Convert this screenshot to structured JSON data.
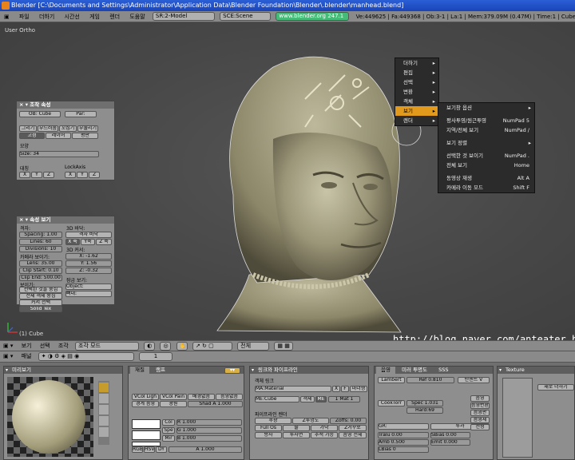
{
  "window": {
    "title": "Blender [C:\\Documents and Settings\\Administrator\\Application Data\\Blender Foundation\\Blender\\.blender\\manhead.blend]"
  },
  "menubar": {
    "items": [
      "파일",
      "더하기",
      "시간선",
      "게임",
      "렌더",
      "도움말"
    ],
    "screen": "SR:2-Model",
    "scene": "SCE:Scene",
    "url": "www.blender.org 247.1",
    "stats": "Ve:449625 | Fa:449368 | Ob:3-1 | La:1 | Mem:379.09M (0.47M) | Time:1 | Cube"
  },
  "viewport": {
    "label": "User Ortho",
    "object_label": "(1) Cube"
  },
  "transform_panel": {
    "title": "조작 속성",
    "ob_field": "OB: Cube",
    "par_field": "Par:",
    "btn_row1": [
      "그리기",
      "부드러움",
      "꼬집기",
      "부풀리기"
    ],
    "btn_row2": [
      "고정",
      "레이어",
      "평판"
    ],
    "shape_label": "모양",
    "size_field": "Size: 34",
    "axis_label": "대칭",
    "lock_label": "LockAxis",
    "axes": [
      "X",
      "Y",
      "Z"
    ]
  },
  "view_panel": {
    "title": "속성 보기",
    "grid_label": "격자:",
    "spacing": "Spacing: 1.00",
    "lines": "Lines: 60",
    "divisions": "Divisions: 10",
    "camera_label": "카메라 보이기:",
    "lens": "Lens: 35.00",
    "clip_start": "Clip Start: 0.10",
    "clip_end": "Clip End: 500.00",
    "show_label": "보이기:",
    "btn_select": "선택된 것을 중심",
    "btn_all": "전체 객체 중심",
    "btn_cursor": "커서 선택",
    "btn_solid": "Solid Tex",
    "floor_label": "3D 바닥:",
    "grid_view": "격자 바닥",
    "axes_btns": [
      "X 축",
      "Y축",
      "Z 축"
    ],
    "cursor_label": "3D 커서:",
    "cx": "X: -1.62",
    "cy": "Y: 1.56",
    "cz": "Z: -0.32",
    "lock_view": "잠금 보기:",
    "object_field": "Object:",
    "bone_field": "뼈대:"
  },
  "main_menu": {
    "items": [
      {
        "label": "더하기",
        "selected": false
      },
      {
        "label": "편집",
        "selected": false
      },
      {
        "label": "선택",
        "selected": false
      },
      {
        "label": "변환",
        "selected": false
      },
      {
        "label": "객체",
        "selected": false
      },
      {
        "label": "보기",
        "selected": true
      },
      {
        "label": "렌더",
        "selected": false
      }
    ]
  },
  "view_submenu": {
    "items": [
      {
        "label": "보기창 옵션",
        "shortcut": "",
        "arrow": true
      },
      {
        "label": "",
        "shortcut": "",
        "arrow": false
      },
      {
        "label": "평사투영/원근투영",
        "shortcut": "NumPad 5",
        "arrow": false
      },
      {
        "label": "지역/전체 보기",
        "shortcut": "NumPad /",
        "arrow": false
      },
      {
        "label": "",
        "shortcut": "",
        "arrow": false
      },
      {
        "label": "보기 정렬",
        "shortcut": "",
        "arrow": true
      },
      {
        "label": "",
        "shortcut": "",
        "arrow": false
      },
      {
        "label": "선택한 것 보이기",
        "shortcut": "NumPad .",
        "arrow": false
      },
      {
        "label": "전체 보기",
        "shortcut": "Home",
        "arrow": false
      },
      {
        "label": "",
        "shortcut": "",
        "arrow": false
      },
      {
        "label": "동영상 재생",
        "shortcut": "Alt A",
        "arrow": false
      },
      {
        "label": "카메라 이동 모드",
        "shortcut": "Shift F",
        "arrow": false
      }
    ]
  },
  "view3d_header": {
    "view": "보기",
    "select": "선택",
    "object": "조각",
    "mode": "조각 모드",
    "layer_field": "전체"
  },
  "watermark": "http://blog.naver.com/anteater_ho",
  "buttons_header": {
    "panels": "패널",
    "frame": "1"
  },
  "preview_panel": {
    "title": "미리보기"
  },
  "material_panel": {
    "tabs": [
      "재질",
      "램프"
    ],
    "btn_row1": [
      "VCol Ligh",
      "VCol Pain",
      "배경없음",
      "음영없음"
    ],
    "btn_row2": [
      "경계 음영",
      "광원",
      "Shad A 1.000"
    ],
    "col_label": "Col",
    "spe_label": "Spe",
    "mir_label": "Mir",
    "r": "R 1.000",
    "g": "G 1.000",
    "b": "B 1.000",
    "modes": [
      "RGB",
      "HSV",
      "DY",
      "A 1.000"
    ]
  },
  "links_panel": {
    "title": "링크와 파이프라인",
    "object_link": "객체 링크",
    "ma_field": "MA:Material",
    "me_field": "ME:Cube",
    "obj_btn": "객체",
    "me_btn": "ME",
    "mat_count": "1 Mat 1",
    "pipeline": "파이프라인 렌더",
    "row1": [
      "후광",
      "Z투명도",
      "Zoffs: 0.00"
    ],
    "row2": [
      "Full Os",
      "줄",
      "가닥",
      "Z거꾸로"
    ],
    "row3": [
      "방사",
      "투사면",
      "추적 가능",
      "음영 전체"
    ],
    "top_btns": [
      "디자",
      "X",
      "F",
      "마더형"
    ]
  },
  "shader_panel": {
    "tabs": [
      "음영",
      "미러 투명도",
      "SSS"
    ],
    "lambert": "Lambert",
    "ref": "Ref 0.810",
    "toon": "탄젠트 V",
    "cooktorr": "CookTorr",
    "spec": "Spec 1.031",
    "hard": "Hard:69",
    "gr": "GR:",
    "tralu": "Tralu 0.00",
    "sbias": "SBias 0.00",
    "amb": "Amb 0.500",
    "emit": "Emit 0.000",
    "lbias": "LBias 0",
    "side_btns": [
      "음영",
      "음영변환",
      "음영판",
      "음영체",
      "전형"
    ],
    "bump": "투과"
  },
  "texture_panel": {
    "title": "Texture",
    "new_btn": "새로 더하기"
  }
}
